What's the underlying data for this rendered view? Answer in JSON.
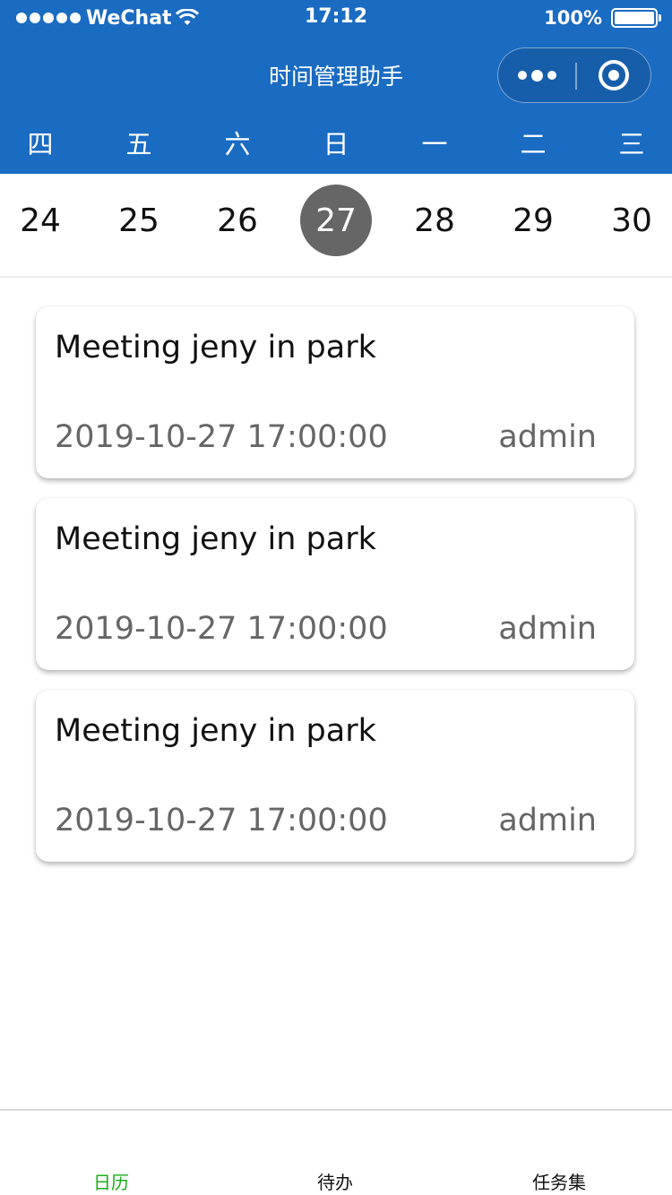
{
  "status_bar": {
    "carrier": "WeChat",
    "time": "17:12",
    "battery": "100%"
  },
  "navbar": {
    "title": "时间管理助手"
  },
  "calendar": {
    "weekdays": [
      "四",
      "五",
      "六",
      "日",
      "一",
      "二",
      "三"
    ],
    "dates": [
      "24",
      "25",
      "26",
      "27",
      "28",
      "29",
      "30"
    ],
    "selected_date": "27"
  },
  "events": [
    {
      "title": "Meeting jeny in park",
      "datetime": "2019-10-27 17:00:00",
      "author": "admin"
    },
    {
      "title": "Meeting jeny in park",
      "datetime": "2019-10-27 17:00:00",
      "author": "admin"
    },
    {
      "title": "Meeting jeny in park",
      "datetime": "2019-10-27 17:00:00",
      "author": "admin"
    }
  ],
  "tabbar": {
    "tabs": [
      "日历",
      "待办",
      "任务集"
    ],
    "active_tab": "日历"
  },
  "colors": {
    "header": "#1a6bc2",
    "selected_date": "#666666",
    "active_tab": "#1aad19"
  }
}
